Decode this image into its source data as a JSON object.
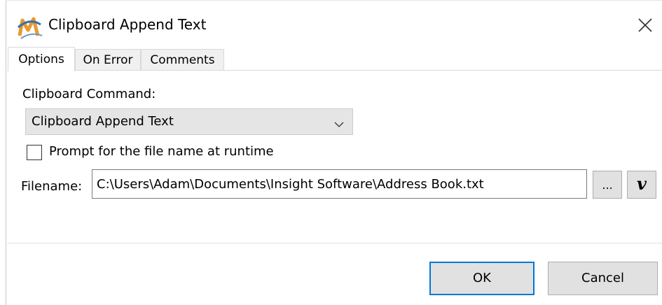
{
  "window": {
    "title": "Clipboard Append Text",
    "app_icon": "macro-m-icon",
    "close_icon": "close-icon"
  },
  "tabs": [
    {
      "label": "Options",
      "active": true
    },
    {
      "label": "On Error",
      "active": false
    },
    {
      "label": "Comments",
      "active": false
    }
  ],
  "options": {
    "command_label": "Clipboard Command:",
    "command_value": "Clipboard Append Text",
    "prompt_checkbox": {
      "label": "Prompt for the file name at runtime",
      "checked": false
    },
    "filename_label": "Filename:",
    "filename_value": "C:\\Users\\Adam\\Documents\\Insight Software\\Address Book.txt",
    "browse_label": "...",
    "variable_label": "v"
  },
  "footer": {
    "ok_label": "OK",
    "cancel_label": "Cancel"
  },
  "colors": {
    "focus_border": "#0078d7",
    "button_bg": "#e1e1e1",
    "combo_bg": "#e5e5e5"
  }
}
